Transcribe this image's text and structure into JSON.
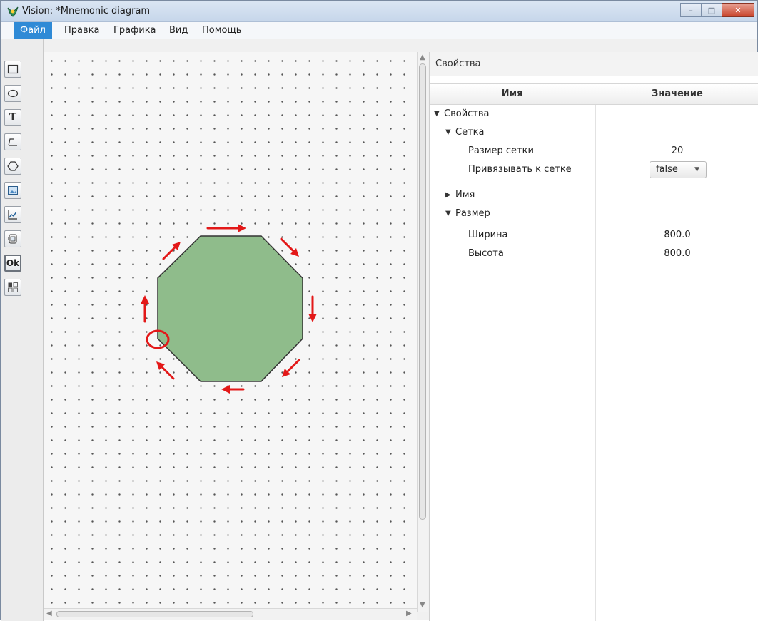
{
  "window": {
    "title": "Vision: *Mnemonic diagram",
    "controls": {
      "minimize": "–",
      "maximize": "□",
      "close": "✕"
    }
  },
  "menu": {
    "items": [
      {
        "label": "Файл",
        "active": true
      },
      {
        "label": "Правка"
      },
      {
        "label": "Графика"
      },
      {
        "label": "Вид"
      },
      {
        "label": "Помощь"
      }
    ]
  },
  "toolbar": {
    "tools": [
      {
        "icon": "rectangle-icon"
      },
      {
        "icon": "ellipse-icon"
      },
      {
        "icon": "text-icon",
        "glyph": "T"
      },
      {
        "icon": "polyline-icon"
      },
      {
        "icon": "polygon-icon"
      },
      {
        "icon": "image-icon"
      },
      {
        "icon": "chart-icon"
      },
      {
        "icon": "gauge-icon"
      },
      {
        "icon": "button-icon",
        "glyph": "Ok"
      },
      {
        "icon": "panel-icon"
      }
    ]
  },
  "canvas": {
    "shape": {
      "type": "octagon",
      "fill": "#8fbc8b",
      "stroke": "#333333"
    },
    "annotation_color": "#e31818"
  },
  "properties": {
    "header": "Свойства",
    "columns": {
      "name": "Имя",
      "value": "Значение"
    },
    "tree": {
      "root": "Свойства",
      "grid": "Сетка",
      "grid_size_label": "Размер сетки",
      "grid_size_value": "20",
      "snap_label": "Привязывать к сетке",
      "snap_value": "false",
      "name": "Имя",
      "size": "Размер",
      "width_label": "Ширина",
      "width_value": "800.0",
      "height_label": "Высота",
      "height_value": "800.0"
    }
  },
  "colors": {
    "menu_active": "#2f8ad6",
    "titlebar": "#c6d6ea"
  }
}
